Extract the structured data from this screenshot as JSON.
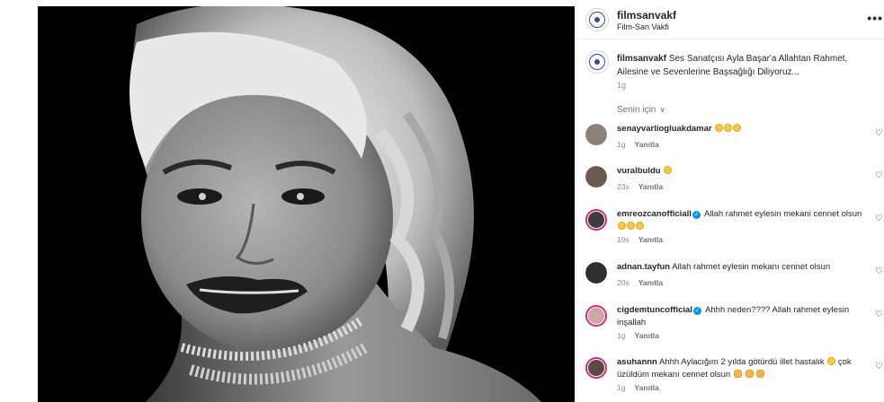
{
  "post": {
    "username": "filmsanvakf",
    "subtitle": "Film-San Vakfi",
    "more_label": "•••",
    "caption_user": "filmsanvakf",
    "caption_text": "Ses Sanatçısı Ayla Başar'a Allahtan Rahmet, Ailesine ve Sevenlerine Başsağlığı Diliyoruz...",
    "caption_time": "1g",
    "for_you_label": "Senin için",
    "reply_label": "Yanıtla"
  },
  "comments": [
    {
      "user": "senayvarliogluakdamar",
      "text": "",
      "verified": false,
      "emojis": 3,
      "emoji_type": "face",
      "time": "1g",
      "avatar_color": "#8a8178"
    },
    {
      "user": "vuralbuldu",
      "text": "",
      "verified": false,
      "emojis": 1,
      "emoji_type": "face",
      "time": "23s",
      "avatar_color": "#6b5a4e"
    },
    {
      "user": "emreozcanofficiall",
      "text": "Allah rahmet eylesin mekani cennet olsun",
      "verified": true,
      "emojis": 3,
      "emoji_type": "face",
      "time": "19s",
      "avatar_color": "#3d3d3d",
      "ring": true
    },
    {
      "user": "adnan.tayfun",
      "text": "Allah rahmet eylesin mekanı cennet olsun",
      "verified": false,
      "emojis": 0,
      "emoji_type": "none",
      "time": "20s",
      "avatar_color": "#2f2f2f"
    },
    {
      "user": "cigdemtuncofficial",
      "text": "Ahhh neden???? Allah rahmet eylesin inşallah",
      "verified": true,
      "emojis": 0,
      "emoji_type": "none",
      "time": "1g",
      "avatar_color": "#c9a9a0",
      "ring": true
    },
    {
      "user": "asuhannn",
      "text": "Ahhh Aylacığım 2 yılda götürdü illet hastalık",
      "text2": "çok üzüldüm mekanı cennet olsun",
      "verified": false,
      "emojis": 1,
      "emoji_type": "face",
      "pray": 3,
      "time": "1g",
      "avatar_color": "#5a4a40",
      "ring": true
    }
  ]
}
